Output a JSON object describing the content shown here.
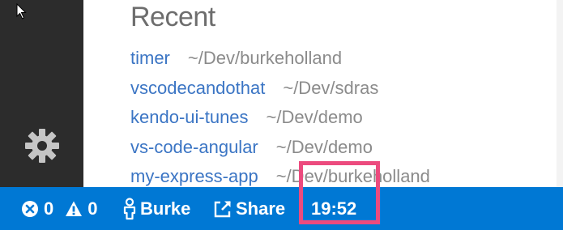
{
  "activity_bar": {
    "icons": [
      "cursor-icon",
      "gear-icon"
    ]
  },
  "welcome": {
    "heading": "Recent",
    "recent": [
      {
        "name": "timer",
        "path": "~/Dev/burkeholland"
      },
      {
        "name": "vscodecandothat",
        "path": "~/Dev/sdras"
      },
      {
        "name": "kendo-ui-tunes",
        "path": "~/Dev/demo"
      },
      {
        "name": "vs-code-angular",
        "path": "~/Dev/demo"
      },
      {
        "name": "my-express-app",
        "path": "~/Dev/burkeholland"
      }
    ]
  },
  "status_bar": {
    "errors": "0",
    "warnings": "0",
    "user": "Burke",
    "share": "Share",
    "clock": "19:52"
  },
  "colors": {
    "status_bar": "#0078d4",
    "activity_bar": "#2c2c2c",
    "link": "#3b75c4",
    "path": "#8b8b8b",
    "highlight": "#ec4b7e"
  }
}
